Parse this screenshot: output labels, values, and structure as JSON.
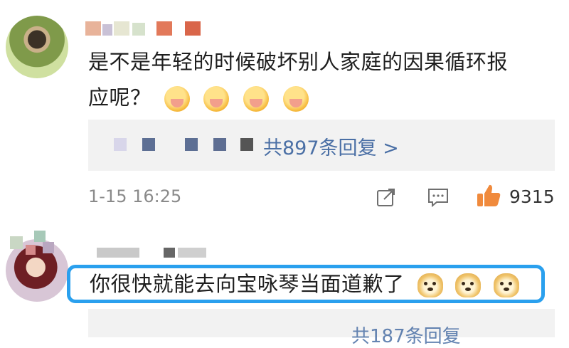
{
  "comments": [
    {
      "text_line1": "是不是年轻的时候破坏别人家庭的因果循环报",
      "text_line2": "应呢？",
      "emoji_names": [
        "hush-emoji",
        "hush-emoji",
        "hush-emoji",
        "hush-emoji"
      ],
      "reply_summary": "共897条回复 >",
      "timestamp": "1-15 16:25",
      "like_count": "9315"
    },
    {
      "text": "你很快就能去向宝咏琴当面道歉了",
      "emoji_names": [
        "doge-emoji",
        "doge-emoji",
        "doge-emoji"
      ],
      "reply_peek": "共187条回复"
    }
  ],
  "colors": {
    "highlight_border": "#2aa0ee",
    "reply_link": "#4a6fa5",
    "like_icon": "#f08a3c",
    "reply_bg": "#f2f2f2"
  },
  "icons": [
    "share-icon",
    "comment-icon",
    "like-thumb-icon"
  ]
}
